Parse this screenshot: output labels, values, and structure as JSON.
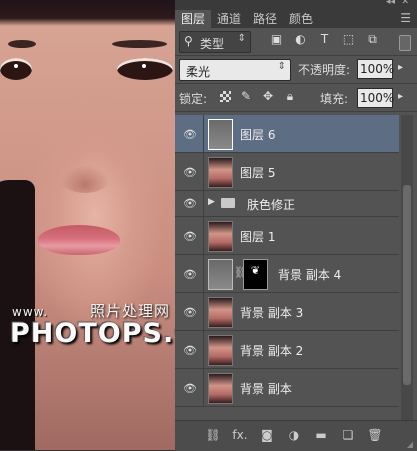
{
  "photo": {
    "watermark_small": "www.",
    "watermark_cn": "照片处理网",
    "watermark_big": "PHOTOPS.COM"
  },
  "panel": {
    "tabs": [
      {
        "label": "图层",
        "active": true
      },
      {
        "label": "通道",
        "active": false
      },
      {
        "label": "路径",
        "active": false
      },
      {
        "label": "颜色",
        "active": false
      }
    ],
    "filter": {
      "kind_label": "类型",
      "icon": "search-icon"
    },
    "blend_mode": "柔光",
    "opacity_label": "不透明度:",
    "opacity_value": "100%",
    "lock_label": "锁定:",
    "fill_label": "填充:",
    "fill_value": "100%",
    "layers": [
      {
        "name": "图层 6",
        "selected": true,
        "type": "pixel-gray"
      },
      {
        "name": "图层 5",
        "selected": false,
        "type": "pixel"
      },
      {
        "name": "肤色修正",
        "selected": false,
        "type": "group"
      },
      {
        "name": "图层 1",
        "selected": false,
        "type": "pixel"
      },
      {
        "name": "背景 副本 4",
        "selected": false,
        "type": "masked"
      },
      {
        "name": "背景 副本 3",
        "selected": false,
        "type": "pixel"
      },
      {
        "name": "背景 副本 2",
        "selected": false,
        "type": "pixel"
      },
      {
        "name": "背景 副本",
        "selected": false,
        "type": "pixel"
      }
    ],
    "bottom_buttons": [
      "link-icon",
      "fx-icon",
      "mask-icon",
      "adjustment-icon",
      "folder-icon",
      "new-layer-icon",
      "trash-icon"
    ],
    "fx_label": "fx.",
    "colors": {
      "panel_bg": "#535353",
      "selected_layer": "#5d6d84",
      "tab_bar": "#3a3a3a"
    }
  }
}
